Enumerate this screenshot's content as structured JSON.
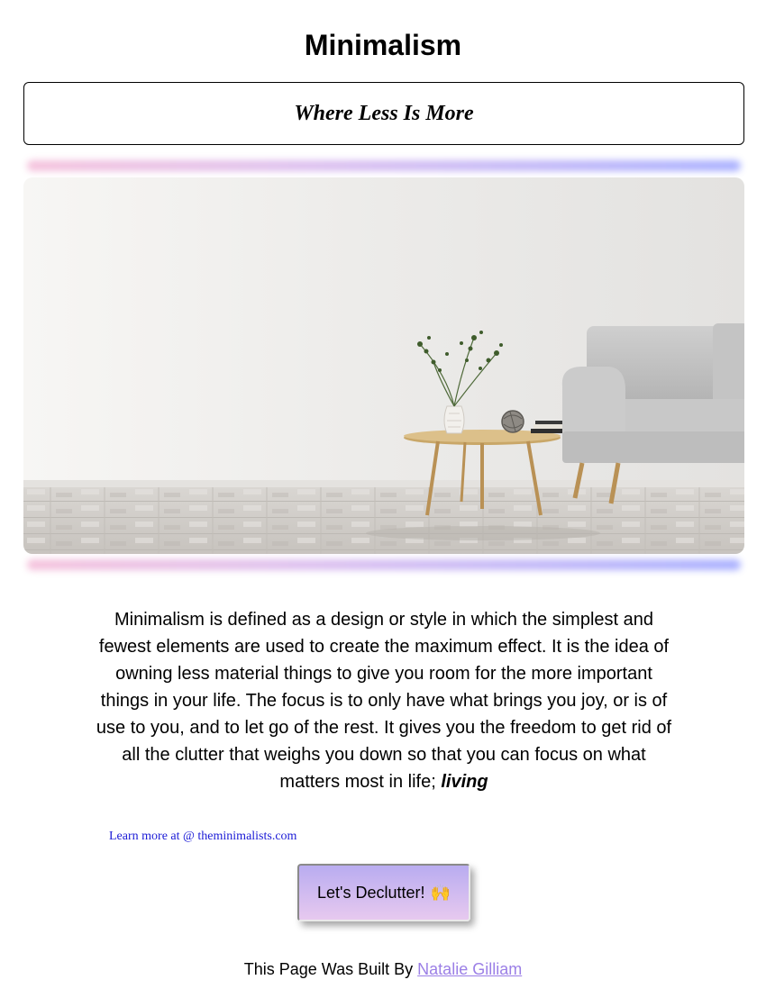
{
  "header": {
    "title": "Minimalism",
    "tagline": "Where Less Is More"
  },
  "hero": {
    "description": "Minimal living room with grey sofa, round wooden coffee table with vase of greenery, books and decorative ball"
  },
  "content": {
    "paragraph": "Minimalism is defined as a design or style in which the simplest and fewest elements are used to create the maximum effect. It is the idea of owning less material things to give you room for the more important things in your life. The focus is to only have what brings you joy, or is of use to you, and to let go of the rest. It gives you the freedom to get rid of all the clutter that weighs you down so that you can focus on what matters most in life; ",
    "emphasis": "living"
  },
  "links": {
    "learn_more": "Learn more at @ theminimalists.com"
  },
  "cta": {
    "label": "Let's Declutter!",
    "emoji": "🙌"
  },
  "footer": {
    "prefix": "This Page Was Built By ",
    "author": "Natalie Gilliam"
  },
  "colors": {
    "link": "#1a1ad6",
    "author_link": "#9b7fe6",
    "button_top": "#b9acf0",
    "button_bottom": "#e7c9ef"
  }
}
